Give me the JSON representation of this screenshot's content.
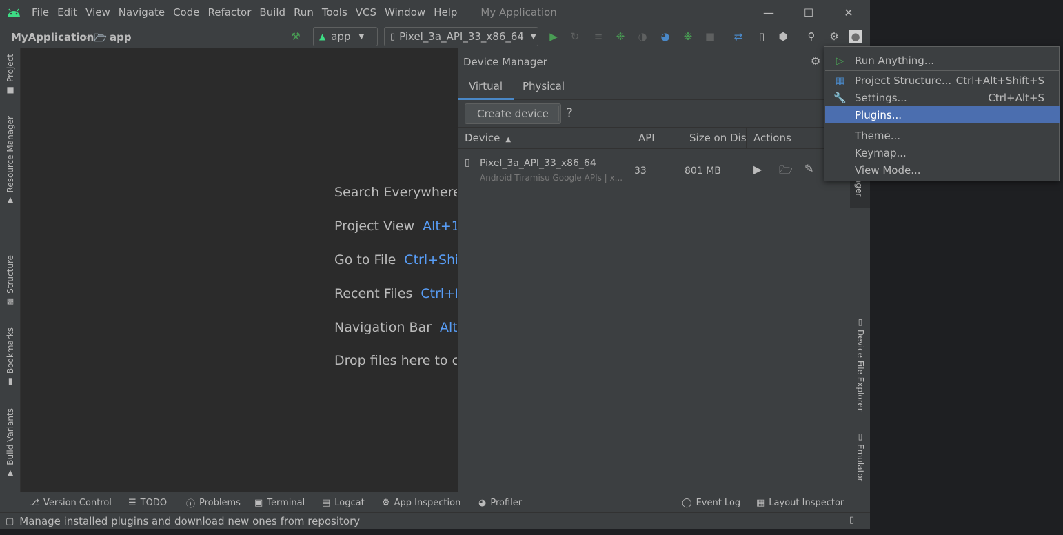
{
  "menu": [
    "File",
    "Edit",
    "View",
    "Navigate",
    "Code",
    "Refactor",
    "Build",
    "Run",
    "Tools",
    "VCS",
    "Window",
    "Help"
  ],
  "app_title": "My Application",
  "breadcrumb": {
    "project": "MyApplication",
    "module": "app"
  },
  "run_config": "app",
  "device_selector": "Pixel_3a_API_33_x86_64",
  "left_tabs": [
    "Project",
    "Resource Manager",
    "Structure",
    "Bookmarks",
    "Build Variants"
  ],
  "right_tabs": [
    "ager",
    "Device File Explorer",
    "Emulator"
  ],
  "editor_hints": [
    {
      "label": "Search Everywhere",
      "key": ""
    },
    {
      "label": "Project View",
      "key": "Alt+1"
    },
    {
      "label": "Go to File",
      "key": "Ctrl+Shi"
    },
    {
      "label": "Recent Files",
      "key": "Ctrl+E"
    },
    {
      "label": "Navigation Bar",
      "key": "Alt-"
    },
    {
      "label": "Drop files here to c",
      "key": ""
    }
  ],
  "device_manager": {
    "title": "Device Manager",
    "tabs": [
      "Virtual",
      "Physical"
    ],
    "create_button": "Create device",
    "help": "?",
    "columns": [
      "Device",
      "API",
      "Size on Disk",
      "Actions"
    ],
    "rows": [
      {
        "name": "Pixel_3a_API_33_x86_64",
        "subtitle": "Android Tiramisu Google APIs | x...",
        "api": "33",
        "size": "801 MB"
      }
    ]
  },
  "popup_menu": [
    {
      "label": "Run Anything...",
      "shortcut": "",
      "icon": "run-anything-icon"
    },
    {
      "label": "Project Structure...",
      "shortcut": "Ctrl+Alt+Shift+S",
      "icon": "project-structure-icon"
    },
    {
      "label": "Settings...",
      "shortcut": "Ctrl+Alt+S",
      "icon": "wrench-icon"
    },
    {
      "label": "Plugins...",
      "shortcut": "",
      "icon": "",
      "selected": true
    },
    {
      "label": "Theme...",
      "shortcut": "",
      "icon": ""
    },
    {
      "label": "Keymap...",
      "shortcut": "",
      "icon": ""
    },
    {
      "label": "View Mode...",
      "shortcut": "",
      "icon": ""
    }
  ],
  "bottom_tabs": [
    "Version Control",
    "TODO",
    "Problems",
    "Terminal",
    "Logcat",
    "App Inspection",
    "Profiler"
  ],
  "bottom_right_tabs": [
    "Event Log",
    "Layout Inspector"
  ],
  "status_text": "Manage installed plugins and download new ones from repository",
  "colors": {
    "accent": "#4b6eaf",
    "link": "#589df6",
    "run_green": "#499c54",
    "bg_dark": "#2b2b2b",
    "panel": "#3c3f41"
  }
}
